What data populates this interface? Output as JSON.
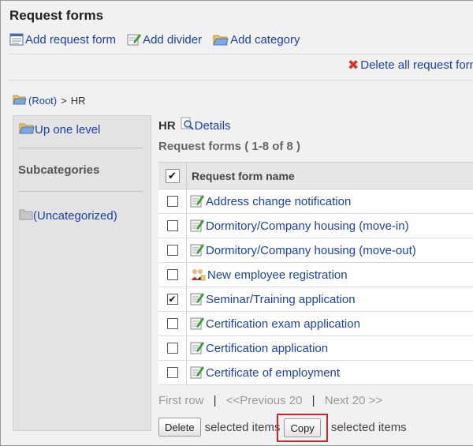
{
  "page": {
    "title": "Request forms"
  },
  "toolbar": {
    "add_request_form": "Add request form",
    "add_divider": "Add divider",
    "add_category": "Add category",
    "delete_all": "Delete all request forms"
  },
  "breadcrumb": {
    "root": "(Root)",
    "separator": ">",
    "current": "HR"
  },
  "sidebar": {
    "up_one_level": "Up one level",
    "subcategories_label": "Subcategories",
    "uncategorized": "(Uncategorized)"
  },
  "category": {
    "name": "HR",
    "details_label": "Details",
    "count_label": "Request forms ( 1-8 of 8 )"
  },
  "table": {
    "header_name": "Request form name",
    "header_checked": true,
    "rows": [
      {
        "name": "Address change notification",
        "checked": false,
        "icon": "form-icon"
      },
      {
        "name": "Dormitory/Company housing (move-in)",
        "checked": false,
        "icon": "form-icon"
      },
      {
        "name": "Dormitory/Company housing (move-out)",
        "checked": false,
        "icon": "form-icon"
      },
      {
        "name": "New employee registration",
        "checked": false,
        "icon": "people-icon"
      },
      {
        "name": "Seminar/Training application",
        "checked": true,
        "icon": "form-icon"
      },
      {
        "name": "Certification exam application",
        "checked": false,
        "icon": "form-icon"
      },
      {
        "name": "Certification application",
        "checked": false,
        "icon": "form-icon"
      },
      {
        "name": "Certificate of employment",
        "checked": false,
        "icon": "form-icon"
      }
    ]
  },
  "pager": {
    "first": "First row",
    "sep": "|",
    "previous": "<<Previous 20",
    "next": "Next 20 >>"
  },
  "actions": {
    "delete_button": "Delete",
    "selected_items_1": "selected items",
    "copy_button": "Copy",
    "selected_items_2": "selected items"
  },
  "colors": {
    "link": "#1a3fb0",
    "highlight": "#d2232a",
    "delete_x": "#d9312b"
  }
}
